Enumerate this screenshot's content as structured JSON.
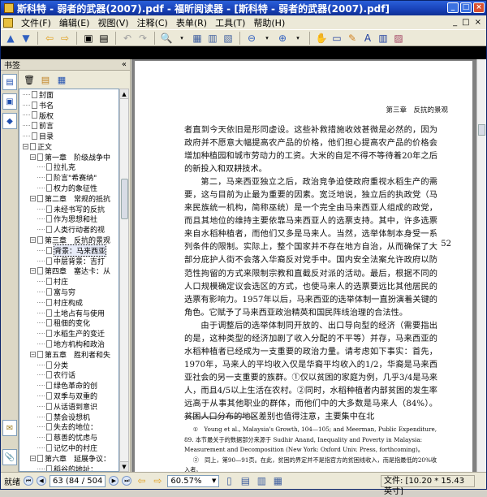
{
  "window": {
    "title": "斯科特 - 弱者的武器(2007).pdf - 福昕阅读器 - [斯科特 - 弱者的武器(2007).pdf]",
    "controls": [
      "_",
      "□",
      "×"
    ]
  },
  "menubar": {
    "items": [
      "文件(F)",
      "编辑(E)",
      "视图(V)",
      "注释(C)",
      "表单(R)",
      "工具(T)",
      "帮助(H)"
    ],
    "right_controls": [
      "_",
      "□",
      "×"
    ]
  },
  "sidebar": {
    "title": "书签",
    "collapse": "«",
    "bookmarks": [
      {
        "label": "封面",
        "level": 0,
        "expander": ""
      },
      {
        "label": "书名",
        "level": 0,
        "expander": ""
      },
      {
        "label": "版权",
        "level": 0,
        "expander": ""
      },
      {
        "label": "前言",
        "level": 0,
        "expander": ""
      },
      {
        "label": "目录",
        "level": 0,
        "expander": ""
      },
      {
        "label": "正文",
        "level": 0,
        "expander": "−"
      },
      {
        "label": "第一章　阶级战争中",
        "level": 1,
        "expander": "−"
      },
      {
        "label": "拉扎克",
        "level": 2,
        "expander": ""
      },
      {
        "label": "阶言\"希赛纳\"",
        "level": 2,
        "expander": ""
      },
      {
        "label": "权力的象征性",
        "level": 2,
        "expander": ""
      },
      {
        "label": "第二章　常规的抵抗",
        "level": 1,
        "expander": "−"
      },
      {
        "label": "未经书写的反抗",
        "level": 2,
        "expander": ""
      },
      {
        "label": "作为思想和社",
        "level": 2,
        "expander": ""
      },
      {
        "label": "人类行动者的视",
        "level": 2,
        "expander": ""
      },
      {
        "label": "第三章　反抗的景观",
        "level": 1,
        "expander": "−"
      },
      {
        "label": "背景：马来西亚",
        "level": 2,
        "expander": "",
        "selected": true
      },
      {
        "label": "中层背景：吉打",
        "level": 2,
        "expander": ""
      },
      {
        "label": "第四章　塞达卡：从",
        "level": 1,
        "expander": "−"
      },
      {
        "label": "村庄",
        "level": 2,
        "expander": ""
      },
      {
        "label": "富与穷",
        "level": 2,
        "expander": ""
      },
      {
        "label": "村庄构成",
        "level": 2,
        "expander": ""
      },
      {
        "label": "土地占有与使用",
        "level": 2,
        "expander": ""
      },
      {
        "label": "租佃的变化",
        "level": 2,
        "expander": ""
      },
      {
        "label": "水稻生产的变迁",
        "level": 2,
        "expander": ""
      },
      {
        "label": "地方机构和政治",
        "level": 2,
        "expander": ""
      },
      {
        "label": "第五章　胜利者和失",
        "level": 1,
        "expander": "−"
      },
      {
        "label": "分类",
        "level": 2,
        "expander": ""
      },
      {
        "label": "农行话",
        "level": 2,
        "expander": ""
      },
      {
        "label": "绿色革命的创",
        "level": 2,
        "expander": ""
      },
      {
        "label": "双季与双重的",
        "level": 2,
        "expander": ""
      },
      {
        "label": "从话语到意识",
        "level": 2,
        "expander": ""
      },
      {
        "label": "禁会设想机",
        "level": 2,
        "expander": ""
      },
      {
        "label": "失去的地位：",
        "level": 2,
        "expander": ""
      },
      {
        "label": "慈善的忧虑与",
        "level": 2,
        "expander": ""
      },
      {
        "label": "记忆中的村庄",
        "level": 2,
        "expander": ""
      },
      {
        "label": "第六章　延展争议：",
        "level": 1,
        "expander": "−"
      },
      {
        "label": "稻谷的地址：",
        "level": 2,
        "expander": ""
      }
    ]
  },
  "document": {
    "running_head": "第三章　反抗的景观",
    "page_number": "52",
    "paragraphs": [
      {
        "indent": false,
        "text": "者直到今天依旧是形同虚设。这些补救措施收效甚微是必然的，因为政府并不愿意大幅提高农产品的价格，他们担心提高农产品的价格会增加种植园和城市劳动力的工资。大米的自足不得不等待着20年之后的新投入和双耕技术。"
      },
      {
        "indent": true,
        "text": "第二，马来西亚独立之后，政治竞争迫使政府重视水稻生产的需要，这与目前为止最为重要的因素。宽泛地说，独立后的执政党（马来民族统一机构，简称巫统）是一个完全由马来西亚人组成的政党，而且其地位的维持主要依靠马来西亚人的选票支持。其中，许多选票来自水稻种植者，而他们又多是马来人。当然，选举体制本身受一系列条件的限制。实际上，整个国家并不存在地方自治，从而确保了大部分庇护人街不会落入华裔反对党手中。国内安全法案允许政府以防范性拘留的方式来限制宗教和直截反对派的活动。最后，根据不同的人口规模确定议会选区的方式，也使马来人的选票要远比其他居民的选票有影响力。1957年以后，马来西亚的选举体制一直扮演着关键的角色。它赋予了马来西亚政治精英和国民阵线治理的合法性。"
      },
      {
        "indent": true,
        "text": "由于调整后的选举体制同开放的、出口导向型的经济（需要指出的是，这种类型的经济加剧了收入分配的不平等）并存，马来西亚的水稻种植者已经成为一支重要的政治力量。请考虑如下事实：首先，1970年，马来人的平均收入仅是华裔平均收入的1/2，华裔是马来西亚社会的另一支重要的族群。①仅以贫困的家庭为例，几乎3/4是马来人，而且4/5以上生活在农村。②同时，水稻种植者内部贫困的发生率远高于从事其他职业的群体，而他们中的大多数是马来人（84%）。贫困人口分布的地区差别也值得注意，主要集中在北"
      }
    ],
    "footnotes": [
      "①　Young et al., Malaysia's Growth, 104—105; and Meerman, Public Expenditure, 89. 本节最关于的数据部分来源于 Sudhir Anand, Inequality and Poverty in Malaysia: Measurement and Decomposition (New York: Oxford Univ. Press, forthcoming)。",
      "②　同上，第90—91页。在此，贫困的界定并不是指官方的贫困线收入，而是指最低的20%收入者。"
    ]
  },
  "statusbar": {
    "ready": "就绪",
    "page_current": "63",
    "page_info": "(84 / 504",
    "zoom": "60.57%",
    "filesize": "文件: [10.20 * 15.43 英寸]"
  },
  "colors": {
    "titlebar": "#1841b8",
    "chrome": "#ece9d8",
    "black_bar": "#000000",
    "viewer_bg": "#808080"
  }
}
